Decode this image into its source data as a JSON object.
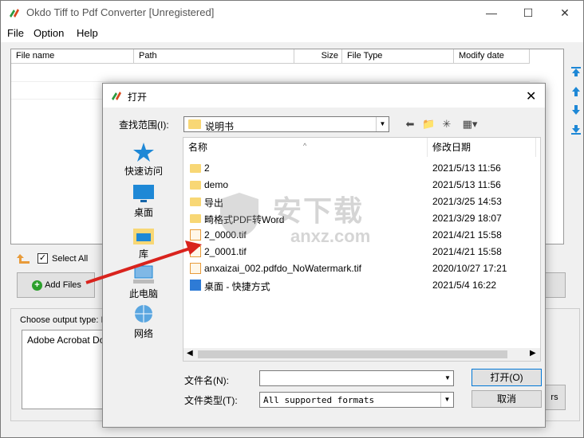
{
  "app": {
    "title": "Okdo Tiff to Pdf Converter [Unregistered]"
  },
  "menu": {
    "file": "File",
    "option": "Option",
    "help": "Help"
  },
  "filelist": {
    "columns": [
      "File name",
      "Path",
      "Size",
      "File Type",
      "Modify date"
    ]
  },
  "controls": {
    "select_all": "Select All",
    "select_all_checked": "✓",
    "add_files": "Add Files",
    "right_btn_partial": "rs"
  },
  "output": {
    "label": "Choose output type:",
    "label_tail": "I",
    "selected": "Adobe Acrobat Do"
  },
  "dialog": {
    "title": "打开",
    "look_in_label": "查找范围(I):",
    "look_in_value": "说明书",
    "columns": {
      "name": "名称",
      "modified": "修改日期"
    },
    "files": [
      {
        "name": "2",
        "date": "2021/5/13 11:56",
        "kind": "folder"
      },
      {
        "name": "demo",
        "date": "2021/5/13 11:56",
        "kind": "folder"
      },
      {
        "name": "导出",
        "date": "2021/3/25 14:53",
        "kind": "folder"
      },
      {
        "name": "畸格式PDF转Word",
        "date": "2021/3/29 18:07",
        "kind": "folder"
      },
      {
        "name": "2_0000.tif",
        "date": "2021/4/21 15:58",
        "kind": "tif"
      },
      {
        "name": "2_0001.tif",
        "date": "2021/4/21 15:58",
        "kind": "tif"
      },
      {
        "name": "anxaizai_002.pdfdo_NoWatermark.tif",
        "date": "2020/10/27 17:21",
        "kind": "tif"
      },
      {
        "name": "桌面 - 快捷方式",
        "date": "2021/5/4 16:22",
        "kind": "shortcut"
      }
    ],
    "places": [
      "快速访问",
      "桌面",
      "库",
      "此电脑",
      "网络"
    ],
    "filename_label": "文件名(N):",
    "filename_value": "",
    "filetype_label": "文件类型(T):",
    "filetype_value": "All supported formats",
    "open_button": "打开(O)",
    "cancel_button": "取消"
  },
  "watermark": {
    "big": "安下载",
    "small": "anxz.com"
  },
  "colors": {
    "accent": "#0078d7",
    "folder": "#f8d775",
    "arrow": "#d9231d",
    "nav_arrow": "#1e88d6"
  }
}
